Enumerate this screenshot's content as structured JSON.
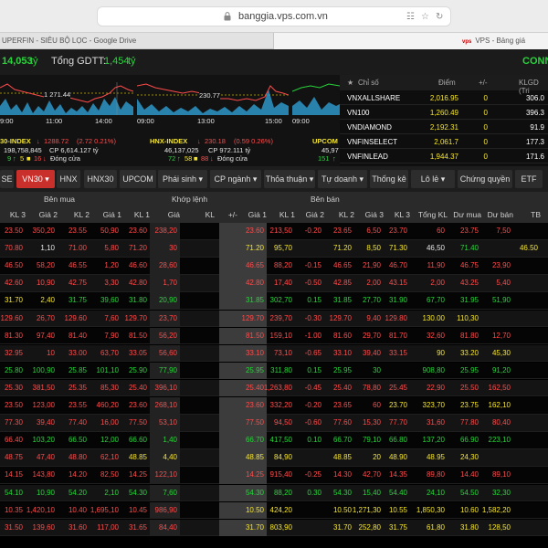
{
  "browser": {
    "url": "banggia.vps.com.vn",
    "lock_icon": "lock-icon",
    "tab_left": "UPERFIN - SIÊU BỘ LỌC - Google Drive",
    "tab_right_logo": "vps",
    "tab_right": "VPS - Bảng giá"
  },
  "summary": {
    "value": "14,053",
    "unit": "tỷ",
    "gdtt_label": "Tổng GDTT:",
    "gdtt": "1,454",
    "gdtt_unit": "tỷ",
    "status": "CONN"
  },
  "charts": [
    {
      "price": "1 271.44",
      "times": [
        "9:00",
        "11:00",
        "14:00"
      ],
      "name": "30-INDEX",
      "idx": "1288.72",
      "chg": "(2.72  0.21%)",
      "vol": "198,758,845",
      "cp": "CP 6,614.127 tỷ",
      "counts": [
        "9",
        "5",
        "16"
      ],
      "status": "Đóng cửa"
    },
    {
      "price": "230.77",
      "times": [
        "09:00",
        "13:00",
        "15:00"
      ],
      "name": "HNX-INDEX",
      "idx": "230.18",
      "chg": "(0.59  0.26%)",
      "vol": "46,137,025",
      "cp": "CP 972.111 tỷ",
      "counts": [
        "72",
        "58",
        "88"
      ],
      "status": "Đóng cửa"
    },
    {
      "times": [
        "09:00"
      ],
      "name": "UPCOM",
      "vol": "45,97",
      "counts": [
        "151"
      ]
    }
  ],
  "indices": {
    "headers": [
      "Chỉ số",
      "Điểm",
      "+/-",
      "KLGD (Tri"
    ],
    "rows": [
      {
        "name": "VNXALLSHARE",
        "point": "2,016.95",
        "chg": "0",
        "vol": "306.0"
      },
      {
        "name": "VN100",
        "point": "1,260.49",
        "chg": "0",
        "vol": "396.3"
      },
      {
        "name": "VNDIAMOND",
        "point": "2,192.31",
        "chg": "0",
        "vol": "91.9"
      },
      {
        "name": "VNFINSELECT",
        "point": "2,061.7",
        "chg": "0",
        "vol": "177.3"
      },
      {
        "name": "VNFINLEAD",
        "point": "1,944.37",
        "chg": "0",
        "vol": "171.6"
      }
    ]
  },
  "toolbar": {
    "items": [
      "SE",
      "VN30",
      "HNX",
      "HNX30",
      "UPCOM",
      "Phái sinh",
      "CP ngành",
      "Thỏa thuận",
      "Tự doanh",
      "Thống kê",
      "Lô lẻ",
      "Chứng quyền",
      "ETF"
    ],
    "chevron_icon": "chevron-down-icon"
  },
  "table_header": {
    "group_buy": "Bên mua",
    "group_match": "Khớp lệnh",
    "group_sell": "Bên bán",
    "cols": [
      "KL 3",
      "Giá 2",
      "KL 2",
      "Giá 1",
      "KL 1",
      "Giá",
      "KL",
      "+/-",
      "Giá 1",
      "KL 1",
      "Giá 2",
      "KL 2",
      "Giá 3",
      "KL 3",
      "Tổng KL",
      "Dư mua",
      "Dư bán",
      "TB"
    ]
  },
  "rows": [
    [
      "23.50",
      "350,20",
      "23.55",
      "50,90",
      "23.60",
      "238,20",
      "",
      "23.60",
      "213,50",
      "-0.20",
      "23.65",
      "6,50",
      "23.70",
      "60",
      "23.75",
      "7,50"
    ],
    [
      "70.80",
      "1,10",
      "71.00",
      "5,80",
      "71.20",
      "30",
      "",
      "71.20",
      "95,70",
      "",
      "71.20",
      "8,50",
      "71.30",
      "46,50",
      "71.40",
      "",
      "46.50"
    ],
    [
      "46.50",
      "58,20",
      "46.55",
      "1,20",
      "46.60",
      "28,60",
      "",
      "46.65",
      "88,20",
      "-0.15",
      "46.65",
      "21,90",
      "46.70",
      "11,90",
      "46.75",
      "23,90"
    ],
    [
      "42.60",
      "10,90",
      "42.75",
      "3,30",
      "42.80",
      "1,70",
      "",
      "42.80",
      "17,40",
      "-0.50",
      "42.85",
      "2,00",
      "43.15",
      "2,00",
      "43.25",
      "5,40"
    ],
    [
      "31.70",
      "2,40",
      "31.75",
      "39,60",
      "31.80",
      "20,90",
      "",
      "31.85",
      "302,70",
      "0.15",
      "31.85",
      "27,70",
      "31.90",
      "67,70",
      "31.95",
      "51,90"
    ],
    [
      "129.60",
      "26,70",
      "129.60",
      "7,60",
      "129.70",
      "23,70",
      "",
      "129.70",
      "239,70",
      "-0.30",
      "129.70",
      "9,40",
      "129.80",
      "130.00",
      "110,30"
    ],
    [
      "81.30",
      "97,40",
      "81.40",
      "7,90",
      "81.50",
      "56,20",
      "",
      "81.50",
      "159,10",
      "-1.00",
      "81.60",
      "29,70",
      "81.70",
      "32,60",
      "81.80",
      "12,70"
    ],
    [
      "32.95",
      "10",
      "33.00",
      "63,70",
      "33.05",
      "56,60",
      "",
      "33.10",
      "73,10",
      "-0.65",
      "33.10",
      "39,40",
      "33.15",
      "90",
      "33.20",
      "45,30"
    ],
    [
      "25.80",
      "100,90",
      "25.85",
      "101,10",
      "25.90",
      "77,90",
      "",
      "25.95",
      "311,80",
      "0.15",
      "25.95",
      "30",
      "",
      "908,80",
      "25.95",
      "91,20"
    ],
    [
      "25.30",
      "381,50",
      "25.35",
      "85,30",
      "25.40",
      "396,10",
      "",
      "25.40",
      "1,263,80",
      "-0.45",
      "25.40",
      "78,80",
      "25.45",
      "22,90",
      "25.50",
      "162,50"
    ],
    [
      "23.50",
      "123,00",
      "23.55",
      "460,20",
      "23.60",
      "268,10",
      "",
      "23.60",
      "332,20",
      "-0.20",
      "23.65",
      "60",
      "23.70",
      "323,70",
      "23.75",
      "162,10"
    ],
    [
      "77.30",
      "39,40",
      "77.40",
      "16,00",
      "77.50",
      "53,10",
      "",
      "77.50",
      "94,50",
      "-0.60",
      "77.60",
      "15,30",
      "77.70",
      "31,60",
      "77.80",
      "80,40"
    ],
    [
      "66.40",
      "103,20",
      "66.50",
      "12,00",
      "66.60",
      "1,40",
      "",
      "66.70",
      "417,50",
      "0.10",
      "66.70",
      "79,10",
      "66.80",
      "137,20",
      "66.90",
      "223,10"
    ],
    [
      "48.75",
      "47,40",
      "48.80",
      "62,10",
      "48.85",
      "4,40",
      "",
      "48.85",
      "84,90",
      "",
      "48.85",
      "20",
      "48.90",
      "48.95",
      "24,30"
    ],
    [
      "14.15",
      "143,80",
      "14.20",
      "82,50",
      "14.25",
      "122,10",
      "",
      "14.25",
      "915,40",
      "-0.25",
      "14.30",
      "42,70",
      "14.35",
      "89,80",
      "14.40",
      "89,10"
    ],
    [
      "54.10",
      "10,90",
      "54.20",
      "2,10",
      "54.30",
      "7,60",
      "",
      "54.30",
      "88,20",
      "0.30",
      "54.30",
      "15,40",
      "54.40",
      "24,10",
      "54.50",
      "32,30"
    ],
    [
      "10.35",
      "1,420,10",
      "10.40",
      "1,695,10",
      "10.45",
      "986,90",
      "",
      "10.50",
      "424,20",
      "",
      "10.50",
      "1,271,30",
      "10.55",
      "1,850,30",
      "10.60",
      "1,582,20"
    ],
    [
      "31.50",
      "139,60",
      "31.60",
      "117,00",
      "31.65",
      "84,40",
      "",
      "31.70",
      "803,90",
      "",
      "31.70",
      "252,80",
      "31.75",
      "61,80",
      "31.80",
      "128,50"
    ]
  ],
  "row_colors": [
    [
      "r",
      "r",
      "r",
      "r",
      "r",
      "r",
      "r",
      "r",
      "r",
      "r",
      "r",
      "r",
      "r",
      "r",
      "r",
      "r",
      "r"
    ],
    [
      "r",
      "w",
      "r",
      "r",
      "r",
      "r",
      "y",
      "y",
      "y",
      "y",
      "y",
      "y",
      "y",
      "w",
      "g",
      "y",
      "y"
    ],
    [
      "r",
      "r",
      "r",
      "r",
      "r",
      "r",
      "r",
      "r",
      "r",
      "r",
      "r",
      "r",
      "r",
      "r",
      "r",
      "r",
      "r"
    ],
    [
      "r",
      "r",
      "r",
      "r",
      "r",
      "r",
      "r",
      "r",
      "r",
      "r",
      "r",
      "r",
      "r",
      "r",
      "r",
      "r",
      "r"
    ],
    [
      "y",
      "y",
      "g",
      "g",
      "g",
      "g",
      "g",
      "g",
      "g",
      "g",
      "g",
      "g",
      "g",
      "g",
      "g",
      "g",
      "g"
    ],
    [
      "r",
      "r",
      "r",
      "r",
      "r",
      "r",
      "r",
      "r",
      "r",
      "r",
      "r",
      "r",
      "r",
      "y",
      "y",
      "y",
      "r"
    ],
    [
      "r",
      "r",
      "r",
      "r",
      "r",
      "r",
      "r",
      "r",
      "r",
      "r",
      "r",
      "r",
      "r",
      "r",
      "r",
      "r",
      "r"
    ],
    [
      "r",
      "r",
      "r",
      "r",
      "r",
      "r",
      "r",
      "r",
      "r",
      "r",
      "r",
      "r",
      "r",
      "y",
      "y",
      "y",
      "r"
    ],
    [
      "g",
      "g",
      "g",
      "g",
      "g",
      "g",
      "g",
      "g",
      "g",
      "g",
      "g",
      "g",
      "w",
      "g",
      "g",
      "g",
      "g"
    ],
    [
      "r",
      "r",
      "r",
      "r",
      "r",
      "r",
      "r",
      "r",
      "r",
      "r",
      "r",
      "r",
      "r",
      "r",
      "r",
      "r",
      "r"
    ],
    [
      "r",
      "r",
      "r",
      "r",
      "r",
      "r",
      "r",
      "r",
      "r",
      "r",
      "r",
      "r",
      "y",
      "y",
      "y",
      "y",
      "y"
    ],
    [
      "r",
      "r",
      "r",
      "r",
      "r",
      "r",
      "r",
      "r",
      "r",
      "r",
      "r",
      "r",
      "r",
      "r",
      "r",
      "r",
      "r"
    ],
    [
      "r",
      "g",
      "g",
      "g",
      "g",
      "g",
      "g",
      "g",
      "g",
      "g",
      "g",
      "g",
      "g",
      "g",
      "g",
      "g",
      "g"
    ],
    [
      "r",
      "r",
      "r",
      "r",
      "y",
      "y",
      "y",
      "y",
      "y",
      "y",
      "y",
      "y",
      "y",
      "y",
      "y",
      "y",
      "y"
    ],
    [
      "r",
      "r",
      "r",
      "r",
      "r",
      "r",
      "r",
      "r",
      "r",
      "r",
      "r",
      "r",
      "r",
      "r",
      "r",
      "r",
      "r"
    ],
    [
      "g",
      "g",
      "g",
      "g",
      "g",
      "g",
      "g",
      "g",
      "g",
      "g",
      "g",
      "g",
      "g",
      "g",
      "g",
      "g",
      "g"
    ],
    [
      "r",
      "r",
      "r",
      "r",
      "r",
      "r",
      "y",
      "y",
      "y",
      "y",
      "y",
      "y",
      "y",
      "y",
      "y",
      "y",
      "y"
    ],
    [
      "r",
      "r",
      "r",
      "r",
      "r",
      "r",
      "y",
      "y",
      "y",
      "y",
      "y",
      "y",
      "y",
      "y",
      "y",
      "y",
      "y"
    ]
  ],
  "index_colors": {
    "name": "#ffffff",
    "point": "#f5e52e",
    "chg": "#f5e52e",
    "vol": "#ffffff"
  },
  "colors": {
    "up": "#29d43b",
    "down": "#ff4b4b",
    "ref": "#f5e52e",
    "ceiling": "#ff46ff",
    "floor": "#21c9ff",
    "active_tab": "#c9302c",
    "connect": "#29d43b"
  }
}
